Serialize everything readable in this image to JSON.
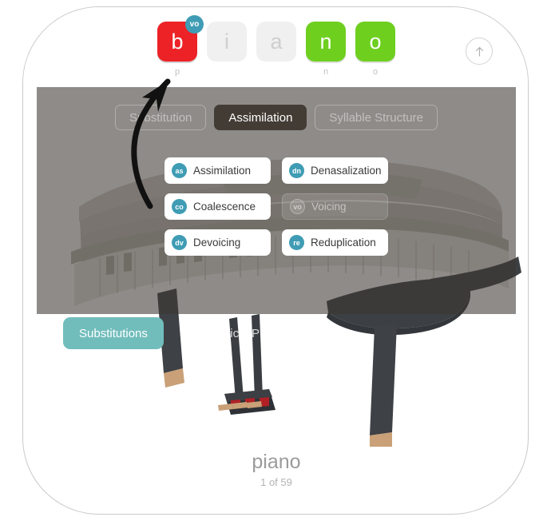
{
  "word_tiles": [
    {
      "letter": "b",
      "color": "red",
      "sublabel": "p",
      "badge": "vo"
    },
    {
      "letter": "i",
      "color": "grey",
      "sublabel": "",
      "badge": ""
    },
    {
      "letter": "a",
      "color": "grey",
      "sublabel": "",
      "badge": ""
    },
    {
      "letter": "n",
      "color": "green",
      "sublabel": "n",
      "badge": ""
    },
    {
      "letter": "o",
      "color": "green",
      "sublabel": "o",
      "badge": ""
    }
  ],
  "share_button": {
    "icon": "arrow-up-icon"
  },
  "segments": [
    {
      "label": "Substitution",
      "active": false
    },
    {
      "label": "Assimilation",
      "active": true
    },
    {
      "label": "Syllable Structure",
      "active": false
    }
  ],
  "options": [
    {
      "badge": "as",
      "label": "Assimilation",
      "disabled": false
    },
    {
      "badge": "dn",
      "label": "Denasalization",
      "disabled": false
    },
    {
      "badge": "co",
      "label": "Coalescence",
      "disabled": false
    },
    {
      "badge": "vo",
      "label": "Voicing",
      "disabled": true
    },
    {
      "badge": "dv",
      "label": "Devoicing",
      "disabled": false
    },
    {
      "badge": "re",
      "label": "Reduplication",
      "disabled": false
    }
  ],
  "bottom_tabs": [
    {
      "label": "Substitutions",
      "active": true
    },
    {
      "label": "Phonological Processes",
      "active": false
    }
  ],
  "caption": {
    "word": "piano",
    "count": "1 of 59"
  },
  "colors": {
    "accent_teal": "#3f9cb4",
    "tab_teal": "#71bdbc",
    "tile_red": "#ec2227",
    "tile_green": "#6ecf1f",
    "tile_grey": "#f0f0f0",
    "segment_active": "#433c35"
  }
}
